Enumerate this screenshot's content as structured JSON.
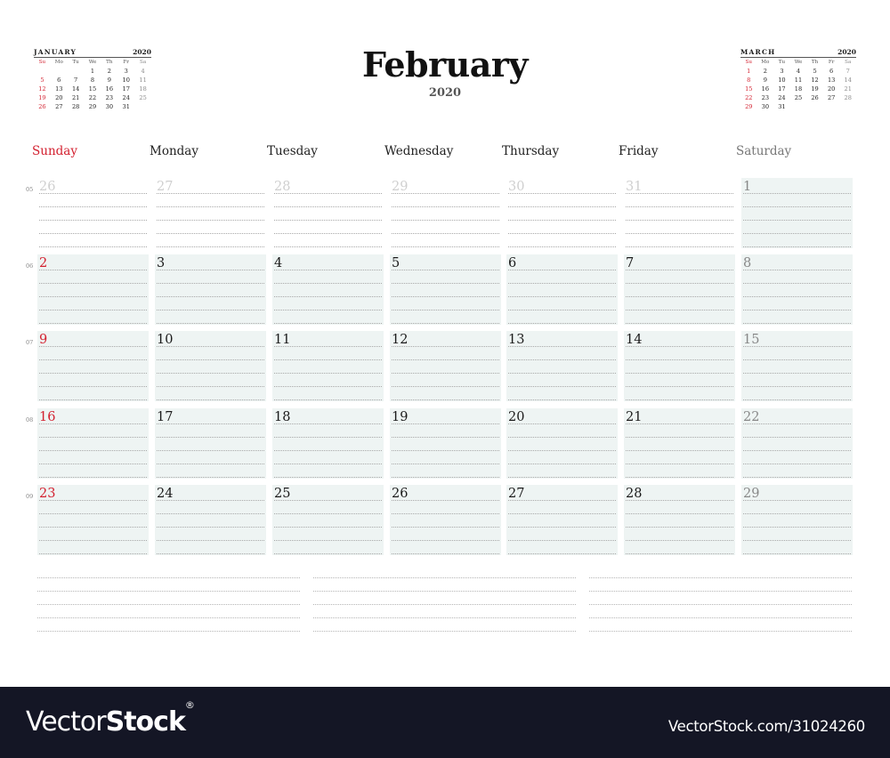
{
  "title": "February",
  "year": "2020",
  "colors": {
    "sunday_red": "#d3202f",
    "saturday_gray": "#777777",
    "cell_shade": "#eef4f3",
    "footer_bg": "#141625"
  },
  "weekdays": [
    "Sunday",
    "Monday",
    "Tuesday",
    "Wednesday",
    "Thursday",
    "Friday",
    "Saturday"
  ],
  "mini_prev": {
    "month": "JANUARY",
    "year": "2020",
    "dow": [
      "Su",
      "Mo",
      "Tu",
      "We",
      "Th",
      "Fr",
      "Sa"
    ],
    "weeks": [
      [
        "",
        "",
        "",
        "1",
        "2",
        "3",
        "4"
      ],
      [
        "5",
        "6",
        "7",
        "8",
        "9",
        "10",
        "11"
      ],
      [
        "12",
        "13",
        "14",
        "15",
        "16",
        "17",
        "18"
      ],
      [
        "19",
        "20",
        "21",
        "22",
        "23",
        "24",
        "25"
      ],
      [
        "26",
        "27",
        "28",
        "29",
        "30",
        "31",
        ""
      ]
    ]
  },
  "mini_next": {
    "month": "MARCH",
    "year": "2020",
    "dow": [
      "Su",
      "Mo",
      "Tu",
      "We",
      "Th",
      "Fr",
      "Sa"
    ],
    "weeks": [
      [
        "1",
        "2",
        "3",
        "4",
        "5",
        "6",
        "7"
      ],
      [
        "8",
        "9",
        "10",
        "11",
        "12",
        "13",
        "14"
      ],
      [
        "15",
        "16",
        "17",
        "18",
        "19",
        "20",
        "21"
      ],
      [
        "22",
        "23",
        "24",
        "25",
        "26",
        "27",
        "28"
      ],
      [
        "29",
        "30",
        "31",
        "",
        "",
        "",
        ""
      ]
    ]
  },
  "weeks": [
    {
      "week_no": "05",
      "days": [
        {
          "d": "26",
          "other": true
        },
        {
          "d": "27",
          "other": true
        },
        {
          "d": "28",
          "other": true
        },
        {
          "d": "29",
          "other": true
        },
        {
          "d": "30",
          "other": true
        },
        {
          "d": "31",
          "other": true
        },
        {
          "d": "1",
          "other": false
        }
      ]
    },
    {
      "week_no": "06",
      "days": [
        {
          "d": "2",
          "other": false
        },
        {
          "d": "3",
          "other": false
        },
        {
          "d": "4",
          "other": false
        },
        {
          "d": "5",
          "other": false
        },
        {
          "d": "6",
          "other": false
        },
        {
          "d": "7",
          "other": false
        },
        {
          "d": "8",
          "other": false
        }
      ]
    },
    {
      "week_no": "07",
      "days": [
        {
          "d": "9",
          "other": false
        },
        {
          "d": "10",
          "other": false
        },
        {
          "d": "11",
          "other": false
        },
        {
          "d": "12",
          "other": false
        },
        {
          "d": "13",
          "other": false
        },
        {
          "d": "14",
          "other": false
        },
        {
          "d": "15",
          "other": false
        }
      ]
    },
    {
      "week_no": "08",
      "days": [
        {
          "d": "16",
          "other": false
        },
        {
          "d": "17",
          "other": false
        },
        {
          "d": "18",
          "other": false
        },
        {
          "d": "19",
          "other": false
        },
        {
          "d": "20",
          "other": false
        },
        {
          "d": "21",
          "other": false
        },
        {
          "d": "22",
          "other": false
        }
      ]
    },
    {
      "week_no": "09",
      "days": [
        {
          "d": "23",
          "other": false
        },
        {
          "d": "24",
          "other": false
        },
        {
          "d": "25",
          "other": false
        },
        {
          "d": "26",
          "other": false
        },
        {
          "d": "27",
          "other": false
        },
        {
          "d": "28",
          "other": false
        },
        {
          "d": "29",
          "other": false
        }
      ]
    }
  ],
  "footer": {
    "brand_thin": "Vector",
    "brand_bold": "Stock",
    "brand_mark": "®",
    "url": "VectorStock.com/31024260"
  }
}
